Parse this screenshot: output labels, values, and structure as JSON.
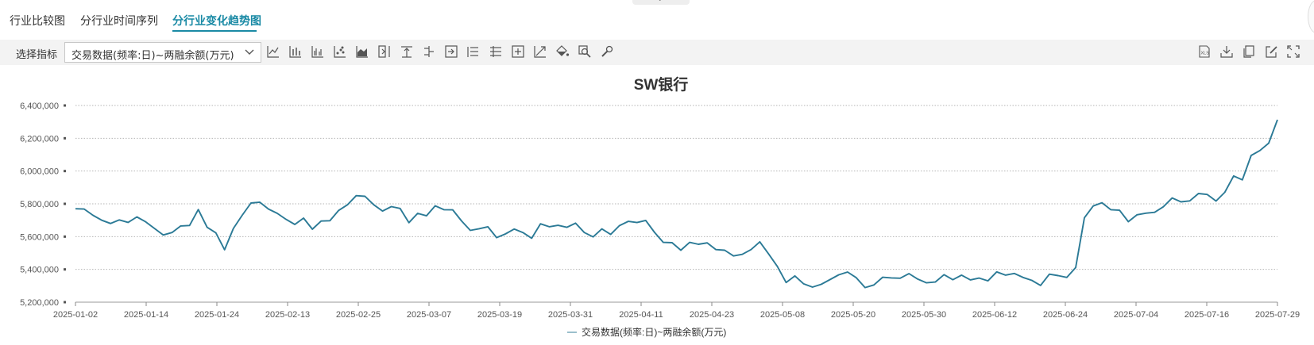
{
  "tabs": [
    {
      "label": "行业比较图",
      "active": false
    },
    {
      "label": "分行业时间序列",
      "active": false
    },
    {
      "label": "分行业变化趋势图",
      "active": true
    }
  ],
  "toolbar": {
    "indicator_label": "选择指标",
    "indicator_value": "交易数据(频率:日)~两融余额(万元)",
    "left_icons": [
      "line-chart-icon",
      "bar-chart-icon",
      "grouped-bar-icon",
      "scatter-icon",
      "area-chart-icon",
      "axis-right-icon",
      "align-top-icon",
      "align-middle-icon",
      "align-right-icon",
      "list-bullets-icon",
      "list-lines-icon",
      "add-box-icon",
      "trend-line-icon",
      "fill-color-icon",
      "zoom-icon",
      "wrench-icon"
    ],
    "right_icons": [
      "export-xls-icon",
      "download-icon",
      "copy-icon",
      "edit-icon",
      "fullscreen-icon"
    ]
  },
  "colors": {
    "accent": "#1a8aa5",
    "series": "#2b7a96",
    "grid": "#b5b5b5"
  },
  "chart_data": {
    "type": "line",
    "title": "SW银行",
    "x_tick_labels": [
      "2025-01-02",
      "2025-01-14",
      "2025-01-24",
      "2025-02-13",
      "2025-02-25",
      "2025-03-07",
      "2025-03-19",
      "2025-03-31",
      "2025-04-11",
      "2025-04-23",
      "2025-05-08",
      "2025-05-20",
      "2025-05-30",
      "2025-06-12",
      "2025-06-24",
      "2025-07-04",
      "2025-07-16",
      "2025-07-29"
    ],
    "y_tick_labels": [
      "5,200,000",
      "5,400,000",
      "5,600,000",
      "5,800,000",
      "6,000,000",
      "6,200,000",
      "6,400,000"
    ],
    "ylim": [
      5200000,
      6400000
    ],
    "grid": true,
    "legend_position": "bottom",
    "series": [
      {
        "name": "交易数据(频率:日)~两融余额(万元)",
        "values": [
          5770000,
          5768000,
          5730000,
          5700000,
          5680000,
          5702000,
          5687000,
          5720000,
          5690000,
          5650000,
          5610000,
          5625000,
          5665000,
          5668000,
          5765000,
          5657000,
          5623000,
          5520000,
          5650000,
          5730000,
          5805000,
          5810000,
          5768000,
          5742000,
          5705000,
          5674000,
          5713000,
          5645000,
          5695000,
          5697000,
          5760000,
          5794000,
          5850000,
          5846000,
          5794000,
          5756000,
          5783000,
          5772000,
          5685000,
          5742000,
          5727000,
          5788000,
          5764000,
          5763000,
          5696000,
          5638000,
          5648000,
          5660000,
          5594000,
          5616000,
          5646000,
          5625000,
          5590000,
          5678000,
          5660000,
          5669000,
          5657000,
          5682000,
          5625000,
          5598000,
          5647000,
          5613000,
          5667000,
          5693000,
          5686000,
          5699000,
          5626000,
          5565000,
          5563000,
          5517000,
          5565000,
          5553000,
          5562000,
          5521000,
          5517000,
          5482000,
          5492000,
          5521000,
          5568000,
          5494000,
          5418000,
          5320000,
          5360000,
          5312000,
          5292000,
          5309000,
          5338000,
          5367000,
          5384000,
          5349000,
          5289000,
          5305000,
          5352000,
          5348000,
          5346000,
          5374000,
          5341000,
          5318000,
          5323000,
          5368000,
          5337000,
          5365000,
          5336000,
          5347000,
          5330000,
          5385000,
          5365000,
          5375000,
          5351000,
          5333000,
          5302000,
          5371000,
          5362000,
          5351000,
          5411000,
          5715000,
          5787000,
          5807000,
          5764000,
          5761000,
          5691000,
          5733000,
          5743000,
          5748000,
          5782000,
          5836000,
          5812000,
          5818000,
          5863000,
          5857000,
          5817000,
          5870000,
          5970000,
          5946000,
          6095000,
          6125000,
          6170000,
          6313000
        ]
      }
    ]
  }
}
